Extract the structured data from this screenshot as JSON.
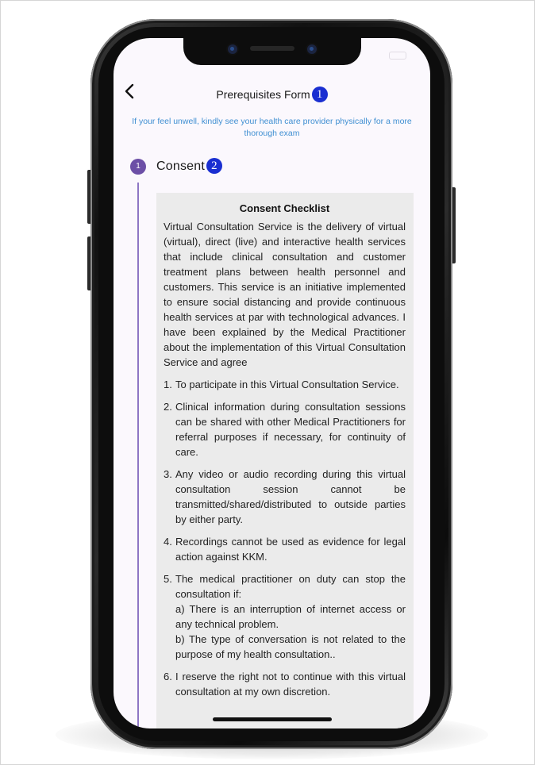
{
  "header": {
    "title": "Prerequisites Form",
    "annotation_1": "1"
  },
  "notice": "If your feel unwell, kindly see your health care provider physically for a more thorough exam",
  "stepper": {
    "step_number": "1",
    "step_label": "Consent",
    "annotation_2": "2"
  },
  "consent": {
    "title": "Consent Checklist",
    "intro": "Virtual Consultation Service is the delivery of virtual (virtual), direct (live) and interactive health services that include clinical consultation and customer treatment plans between health personnel and customers. This service is an initiative implemented to ensure social distancing and provide continuous health services at par with technological advances. I have been explained by the Medical Practitioner about the implementation of this Virtual Consultation Service and agree",
    "items": [
      {
        "num": "1.",
        "text": "To participate in this Virtual Consultation Service."
      },
      {
        "num": "2.",
        "text": "Clinical information during consultation sessions can be shared with other Medical Practitioners for referral purposes if necessary, for continuity of care."
      },
      {
        "num": "3.",
        "text": "Any video or audio recording during this virtual consultation session cannot be transmitted/shared/distributed to outside parties by either party."
      },
      {
        "num": "4.",
        "text": "Recordings cannot be used as evidence for legal action against KKM."
      },
      {
        "num": "5.",
        "text": "The medical practitioner on duty can stop the consultation if:",
        "sub_a": "a) There is an interruption of internet access or any technical problem.",
        "sub_b": "b) The type of conversation is not related to the purpose of my health consultation.."
      },
      {
        "num": "6.",
        "text": "I reserve the right not to continue with this virtual consultation at my own discretion."
      }
    ]
  },
  "colors": {
    "accent_purple": "#6c4fa6",
    "notice_blue": "#3f8fd2",
    "badge_blue": "#1a2fd1",
    "card_bg": "#ebebeb"
  },
  "icons": {
    "back": "chevron-left-icon"
  }
}
